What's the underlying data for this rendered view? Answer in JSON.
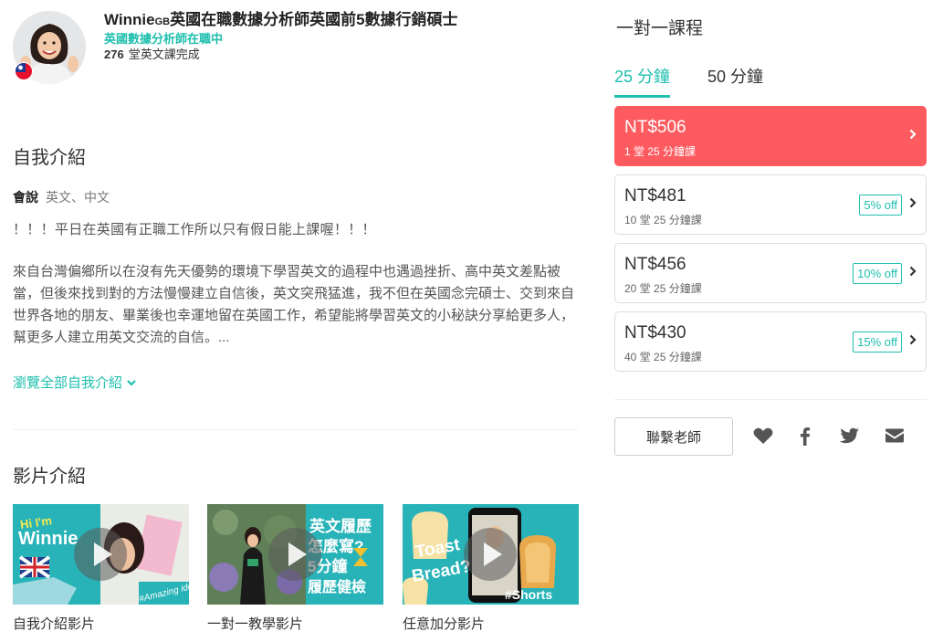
{
  "profile": {
    "name_main": "Winnie",
    "name_gb": "GB",
    "name_rest": "英國在職數據分析師英國前5數據行銷碩士",
    "subtitle": "英國數據分析師在職中",
    "lessons_count": "276",
    "lessons_label": "堂英文課完成"
  },
  "intro": {
    "heading": "自我介紹",
    "speaks_label": "會說",
    "speaks_value": "英文、中文",
    "notice": "！！！平日在英國有正職工作所以只有假日能上課喔！！！",
    "bio": "來自台灣偏鄉所以在沒有先天優勢的環境下學習英文的過程中也遇過挫折、高中英文差點被當，但後來找到對的方法慢慢建立自信後，英文突飛猛進，我不但在英國念完碩士、交到來自世界各地的朋友、畢業後也幸運地留在英國工作，希望能將學習英文的小秘訣分享給更多人，幫更多人建立用英文交流的自信。...",
    "more_link": "瀏覽全部自我介紹"
  },
  "videos": {
    "heading": "影片介紹",
    "items": [
      {
        "caption": "自我介紹影片",
        "thumb_text_1": "Hi I'm",
        "thumb_text_2": "Winnie",
        "thumb_tag": "#Amazing idea"
      },
      {
        "caption": "一對一教學影片",
        "thumb_text_1": "英文履歷",
        "thumb_text_2": "怎麼寫?",
        "thumb_text_3": "5分鐘",
        "thumb_text_4": "履歷健檢"
      },
      {
        "caption": "任意加分影片",
        "thumb_text_1": "Toast",
        "thumb_text_2": "Bread?",
        "thumb_tag": "#Shorts"
      }
    ]
  },
  "pricing": {
    "title": "一對一課程",
    "tabs": [
      {
        "label": "25 分鐘",
        "active": true
      },
      {
        "label": "50 分鐘",
        "active": false
      }
    ],
    "options": [
      {
        "price": "NT$506",
        "desc": "1 堂 25 分鐘課",
        "discount": "",
        "selected": true
      },
      {
        "price": "NT$481",
        "desc": "10 堂 25 分鐘課",
        "discount": "5% off",
        "selected": false
      },
      {
        "price": "NT$456",
        "desc": "20 堂 25 分鐘課",
        "discount": "10% off",
        "selected": false
      },
      {
        "price": "NT$430",
        "desc": "40 堂 25 分鐘課",
        "discount": "15% off",
        "selected": false
      }
    ],
    "contact_label": "聯繫老師"
  },
  "icons": {
    "social": [
      "heart-icon",
      "facebook-icon",
      "twitter-icon",
      "mail-icon"
    ]
  },
  "colors": {
    "accent": "#1ebfae",
    "selected_price": "#fd5b60",
    "icon": "#555555"
  }
}
